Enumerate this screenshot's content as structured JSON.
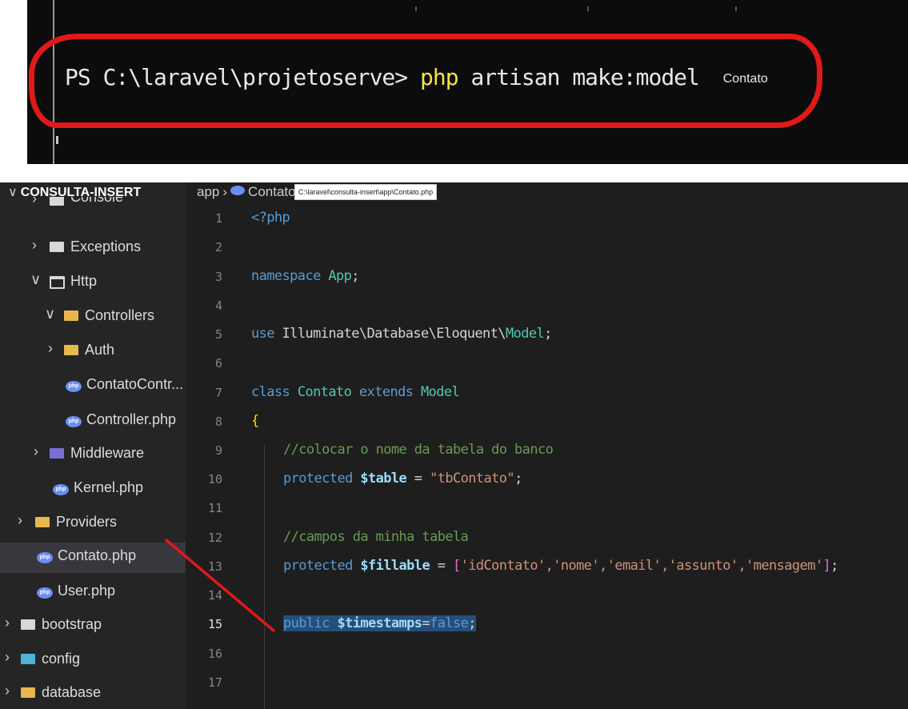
{
  "terminal": {
    "prompt": "PS C:\\laravel\\projetoserve>",
    "command": "php",
    "args": "artisan make:model",
    "model_name": "Contato"
  },
  "explorer": {
    "header": "CONSULTA-INSERT",
    "items": [
      {
        "label": "Console",
        "kind": "folder",
        "expanded": false
      },
      {
        "label": "Exceptions",
        "kind": "folder",
        "expanded": false
      },
      {
        "label": "Http",
        "kind": "folder",
        "expanded": true
      },
      {
        "label": "Controllers",
        "kind": "folder",
        "expanded": true
      },
      {
        "label": "Auth",
        "kind": "folder",
        "expanded": false
      },
      {
        "label": "ContatoContr...",
        "kind": "php"
      },
      {
        "label": "Controller.php",
        "kind": "php"
      },
      {
        "label": "Middleware",
        "kind": "folder",
        "expanded": false
      },
      {
        "label": "Kernel.php",
        "kind": "php"
      },
      {
        "label": "Providers",
        "kind": "folder",
        "expanded": false
      },
      {
        "label": "Contato.php",
        "kind": "php",
        "selected": true
      },
      {
        "label": "User.php",
        "kind": "php"
      },
      {
        "label": "bootstrap",
        "kind": "folder",
        "expanded": false
      },
      {
        "label": "config",
        "kind": "folder",
        "expanded": false
      },
      {
        "label": "database",
        "kind": "folder",
        "expanded": false
      }
    ]
  },
  "breadcrumb": {
    "folder": "app",
    "file": "Contato.p",
    "tooltip": "C:\\laravel\\consulta-insert\\app\\Contato.php"
  },
  "editor": {
    "active_line": 15,
    "line_numbers": [
      "1",
      "2",
      "3",
      "4",
      "5",
      "6",
      "7",
      "8",
      "9",
      "10",
      "11",
      "12",
      "13",
      "14",
      "15",
      "16",
      "17"
    ],
    "code": {
      "l1": "<?php",
      "l3_kw": "namespace",
      "l3_ns": "App",
      "l3_end": ";",
      "l5_kw": "use",
      "l5_path": "Illuminate\\Database\\Eloquent\\",
      "l5_cls": "Model",
      "l5_end": ";",
      "l7_kw": "class",
      "l7_name": "Contato",
      "l7_ext": "extends",
      "l7_parent": "Model",
      "l8": "{",
      "l9": "//colocar o nome da tabela do banco",
      "l10_kw": "protected",
      "l10_var": "$table",
      "l10_eq": " = ",
      "l10_str": "\"tbContato\"",
      "l10_end": ";",
      "l12": "//campos da minha tabela",
      "l13_kw": "protected",
      "l13_var": "$fillable",
      "l13_eq": " = ",
      "l13_open": "[",
      "l13_items": "'idContato','nome','email','assunto','mensagem'",
      "l13_close": "]",
      "l13_end": ";",
      "l15_kw": "public",
      "l15_var": "$timestamps",
      "l15_eq": "=",
      "l15_val": "false",
      "l15_end": ";"
    }
  },
  "colors": {
    "annotation_red": "#e01919",
    "editor_bg": "#1e1e1e",
    "sidebar_bg": "#252526"
  }
}
